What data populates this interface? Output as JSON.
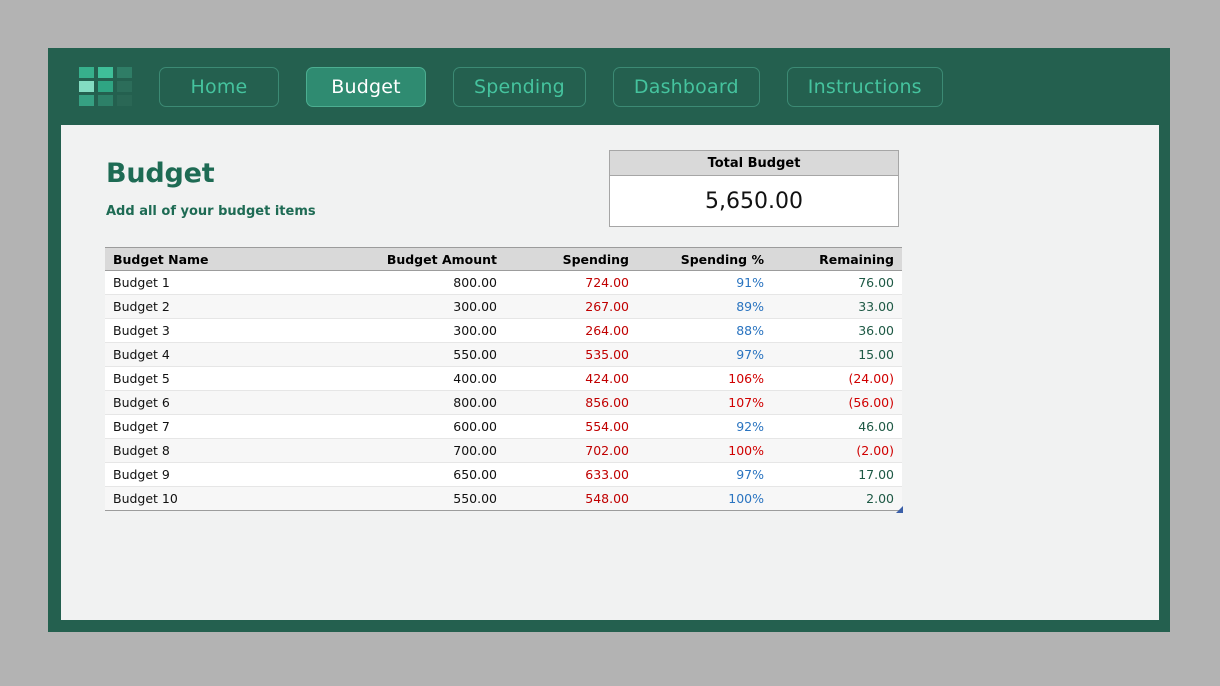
{
  "window": {
    "background_color": "#b3b3b3",
    "frame_color": "#24604f",
    "content_background": "#f1f2f2"
  },
  "header": {
    "logo": {
      "icon_name": "grid-logo-icon",
      "cells": [
        "logo-cell-1",
        "logo-cell-2",
        "logo-cell-3",
        "logo-cell-4",
        "logo-cell-5",
        "logo-cell-6",
        "logo-cell-7",
        "logo-cell-8",
        "logo-cell-9"
      ]
    },
    "nav": [
      {
        "label": "Home",
        "active": false
      },
      {
        "label": "Budget",
        "active": true
      },
      {
        "label": "Spending",
        "active": false
      },
      {
        "label": "Dashboard",
        "active": false
      },
      {
        "label": "Instructions",
        "active": false
      }
    ],
    "accent_active_bg": "#2f8b71",
    "accent_text": "#45c39e"
  },
  "page": {
    "title": "Budget",
    "subtitle": "Add all of your budget items",
    "title_color": "#1e6b54"
  },
  "total_budget_card": {
    "header_label": "Total Budget",
    "value": "5,650.00",
    "header_bg": "#d9d9d9",
    "border_color": "#a6a6a6"
  },
  "table": {
    "columns": [
      "Budget Name",
      "Budget Amount",
      "Spending",
      "Spending %",
      "Remaining"
    ],
    "header_bg": "#d9d9d9",
    "colors": {
      "spending": "#c00000",
      "percent_ok": "#2a74c0",
      "percent_over": "#d00000",
      "remaining_positive": "#1e5945",
      "remaining_negative": "#d00000"
    },
    "rows": [
      {
        "name": "Budget 1",
        "amount": "800.00",
        "spending": "724.00",
        "percent": "91%",
        "percent_state": "ok",
        "remaining": "76.00",
        "remaining_state": "pos"
      },
      {
        "name": "Budget 2",
        "amount": "300.00",
        "spending": "267.00",
        "percent": "89%",
        "percent_state": "ok",
        "remaining": "33.00",
        "remaining_state": "pos"
      },
      {
        "name": "Budget 3",
        "amount": "300.00",
        "spending": "264.00",
        "percent": "88%",
        "percent_state": "ok",
        "remaining": "36.00",
        "remaining_state": "pos"
      },
      {
        "name": "Budget 4",
        "amount": "550.00",
        "spending": "535.00",
        "percent": "97%",
        "percent_state": "ok",
        "remaining": "15.00",
        "remaining_state": "pos"
      },
      {
        "name": "Budget 5",
        "amount": "400.00",
        "spending": "424.00",
        "percent": "106%",
        "percent_state": "over",
        "remaining": "(24.00)",
        "remaining_state": "neg"
      },
      {
        "name": "Budget 6",
        "amount": "800.00",
        "spending": "856.00",
        "percent": "107%",
        "percent_state": "over",
        "remaining": "(56.00)",
        "remaining_state": "neg"
      },
      {
        "name": "Budget 7",
        "amount": "600.00",
        "spending": "554.00",
        "percent": "92%",
        "percent_state": "ok",
        "remaining": "46.00",
        "remaining_state": "pos"
      },
      {
        "name": "Budget 8",
        "amount": "700.00",
        "spending": "702.00",
        "percent": "100%",
        "percent_state": "over",
        "remaining": "(2.00)",
        "remaining_state": "neg"
      },
      {
        "name": "Budget 9",
        "amount": "650.00",
        "spending": "633.00",
        "percent": "97%",
        "percent_state": "ok",
        "remaining": "17.00",
        "remaining_state": "pos"
      },
      {
        "name": "Budget 10",
        "amount": "550.00",
        "spending": "548.00",
        "percent": "100%",
        "percent_state": "ok",
        "remaining": "2.00",
        "remaining_state": "pos"
      }
    ]
  }
}
